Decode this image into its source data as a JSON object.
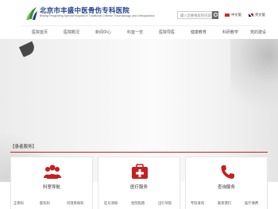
{
  "header": {
    "hospital_name": "北京市丰盛中医骨伤专科医院",
    "hospital_name_en": "Beijing Fengsheng Special Hospital of Traditional Chinese Traumatology and Orthopaedics",
    "search_placeholder": "输入您要搜索的内容",
    "lang_cn": "中文版",
    "lang_en": "英文版"
  },
  "nav": {
    "items": [
      "医院首页",
      "医院概况",
      "新闻中心",
      "科室一览",
      "医院导医",
      "健康教育",
      "科研教学",
      "党的建设"
    ]
  },
  "services": {
    "section_title": "【患者服务】",
    "cards": [
      {
        "title": "科室导航",
        "icon": "people-icon",
        "subs": [
          "正骨科",
          "筋伤科",
          "风湿骨病科"
        ]
      },
      {
        "title": "医疗服务",
        "icon": "medical-kit-icon",
        "subs": [
          "挂号须知",
          "住院指南",
          "出行导航"
        ]
      },
      {
        "title": "查询服务",
        "icon": "phone-icon",
        "subs": [
          "专科查询",
          "联系我们",
          "医疗收费"
        ]
      }
    ]
  },
  "colors": {
    "brand_blue": "#1f3f8c",
    "accent_red": "#c81e1e",
    "icon_gray": "#6b6b6b"
  }
}
